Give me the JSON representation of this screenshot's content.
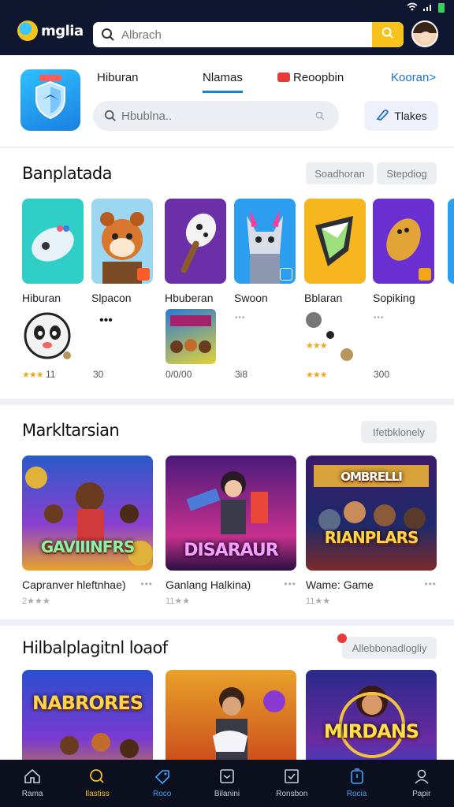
{
  "status": {
    "icons": [
      "wifi-icon",
      "signal-icon",
      "battery-icon"
    ],
    "battery_color": "#39d05f"
  },
  "topbar": {
    "logo_text": "mglia",
    "search_placeholder": "Albrach",
    "bg": "#0f1630",
    "accent": "#f6c21c"
  },
  "header": {
    "tabs": [
      {
        "label": "Hiburan"
      },
      {
        "label": "Nlamas"
      },
      {
        "label": "Reoopbin"
      },
      {
        "label": "Kooran>"
      }
    ],
    "search_placeholder": "Hbublna..",
    "filter_label": "Tlakes"
  },
  "section1": {
    "title": "Banplatada",
    "chips": [
      "Soadhoran",
      "Stepdiog"
    ],
    "apps": [
      {
        "name": "Hiburan"
      },
      {
        "name": "Slpacon"
      },
      {
        "name": "Hbuberan"
      },
      {
        "name": "Swoon"
      },
      {
        "name": "Bblaran"
      },
      {
        "name": "Sopiking"
      }
    ],
    "row2": [
      {
        "rating": "11"
      },
      {
        "rating": "30"
      },
      {
        "rating": "0/0/00"
      },
      {
        "rating": "3i8"
      },
      {
        "rating": ""
      },
      {
        "rating": "300"
      }
    ]
  },
  "section2": {
    "title": "Markltarsian",
    "chip": "Ifetbklonely",
    "cards": [
      {
        "title": "Capranver hleftnhae)",
        "art": "GAVIIINFRS",
        "meta": "2★★★"
      },
      {
        "title": "Ganlang Halkina)",
        "art": "DISARAUR",
        "meta": "11★★"
      },
      {
        "title": "Wame: Game",
        "art": "RIANPLARS",
        "meta": "11★★"
      }
    ]
  },
  "section3": {
    "title": "Hilbalplagitnl loaof",
    "chip": "Allebbonadlogliy",
    "cards": [
      {
        "art": "NABRORES"
      },
      {
        "art": ""
      },
      {
        "art": "MIRDANS"
      }
    ]
  },
  "bottomnav": [
    {
      "label": "Rama",
      "icon": "home-icon"
    },
    {
      "label": "Ilastiss",
      "icon": "search-icon"
    },
    {
      "label": "Roco",
      "icon": "tag-icon"
    },
    {
      "label": "Bilanini",
      "icon": "inbox-icon"
    },
    {
      "label": "Ronsbon",
      "icon": "check-icon"
    },
    {
      "label": "Rocia",
      "icon": "timer-icon"
    },
    {
      "label": "Papir",
      "icon": "profile-icon"
    }
  ]
}
